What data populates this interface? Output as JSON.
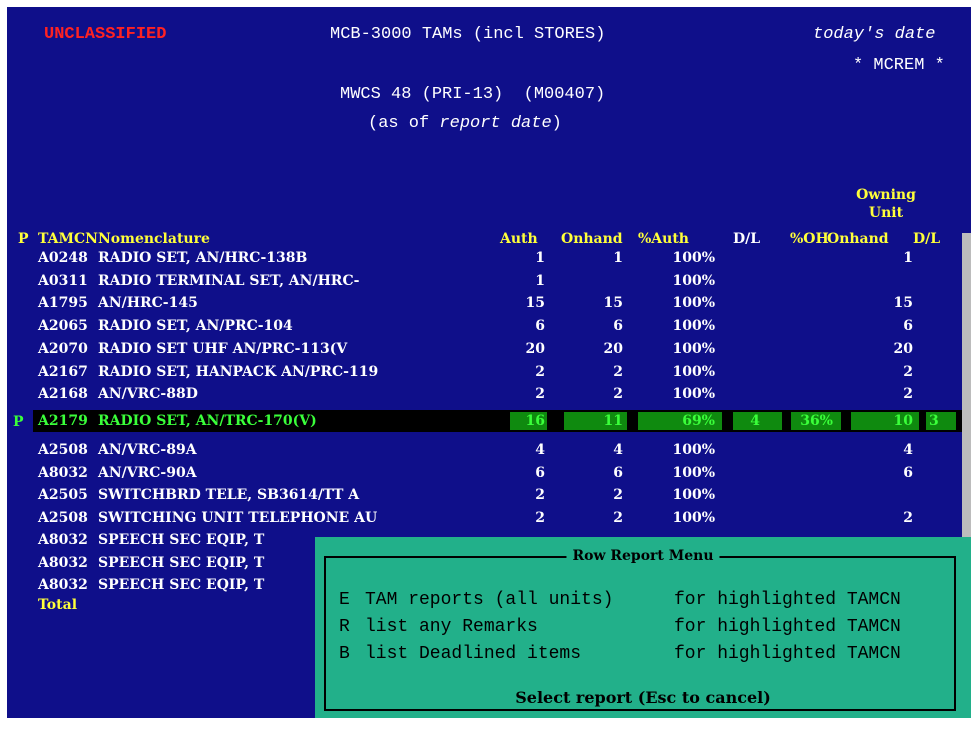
{
  "header": {
    "classification": "UNCLASSIFIED",
    "title": "MCB-3000 TAMs (incl STORES)",
    "date_label": "today's date",
    "command": "* MCREM *",
    "subtitle": "MWCS 48 (PRI-13)  (M00407)",
    "asof_prefix": "(as of ",
    "asof_italic": "report date",
    "asof_suffix": ")"
  },
  "columns": {
    "owning_line1": "Owning",
    "owning_line2": "Unit",
    "p": "P",
    "tamcn": "TAMCN",
    "nomenclature": "Nomenclature",
    "auth": "Auth",
    "onhand": "Onhand",
    "pct_auth": "%Auth",
    "dl": "D/L",
    "pct_oh": "%OH",
    "unit_onhand": "Onhand",
    "unit_dl": "D/L"
  },
  "rows": [
    {
      "tamcn": "A0248",
      "nom": "RADIO SET, AN/HRC-138B",
      "auth": "1",
      "onhand": "1",
      "pct": "100%",
      "dl": "",
      "pctoh": "",
      "uoh": "1",
      "udl": ""
    },
    {
      "tamcn": "A0311",
      "nom": "RADIO TERMINAL SET, AN/HRC-",
      "auth": "1",
      "onhand": "",
      "pct": "100%",
      "dl": "",
      "pctoh": "",
      "uoh": "",
      "udl": ""
    },
    {
      "tamcn": "A1795",
      "nom": "AN/HRC-145",
      "auth": "15",
      "onhand": "15",
      "pct": "100%",
      "dl": "",
      "pctoh": "",
      "uoh": "15",
      "udl": ""
    },
    {
      "tamcn": "A2065",
      "nom": "RADIO SET, AN/PRC-104",
      "auth": "6",
      "onhand": "6",
      "pct": "100%",
      "dl": "",
      "pctoh": "",
      "uoh": "6",
      "udl": ""
    },
    {
      "tamcn": "A2070",
      "nom": "RADIO SET UHF AN/PRC-113(V",
      "auth": "20",
      "onhand": "20",
      "pct": "100%",
      "dl": "",
      "pctoh": "",
      "uoh": "20",
      "udl": ""
    },
    {
      "tamcn": "A2167",
      "nom": "RADIO SET, HANPACK AN/PRC-119",
      "auth": "2",
      "onhand": "2",
      "pct": "100%",
      "dl": "",
      "pctoh": "",
      "uoh": "2",
      "udl": ""
    },
    {
      "tamcn": "A2168",
      "nom": "AN/VRC-88D",
      "auth": "2",
      "onhand": "2",
      "pct": "100%",
      "dl": "",
      "pctoh": "",
      "uoh": "2",
      "udl": ""
    }
  ],
  "highlight_row": {
    "p": "P",
    "tamcn": "A2179",
    "nom": "RADIO SET, AN/TRC-170(V)",
    "auth": "16",
    "onhand": "11",
    "pct": "69%",
    "dl": "4",
    "pctoh": "36%",
    "uoh": "10",
    "udl": "3"
  },
  "rows2": [
    {
      "tamcn": "A2508",
      "nom": "AN/VRC-89A",
      "auth": "4",
      "onhand": "4",
      "pct": "100%",
      "uoh": "4"
    },
    {
      "tamcn": "A8032",
      "nom": "AN/VRC-90A",
      "auth": "6",
      "onhand": "6",
      "pct": "100%",
      "uoh": "6"
    },
    {
      "tamcn": "A2505",
      "nom": "SWITCHBRD TELE, SB3614/TT A",
      "auth": "2",
      "onhand": "2",
      "pct": "100%",
      "uoh": ""
    },
    {
      "tamcn": "A2508",
      "nom": "SWITCHING UNIT TELEPHONE AU",
      "auth": "2",
      "onhand": "2",
      "pct": "100%",
      "uoh": "2"
    }
  ],
  "rows3": [
    {
      "tamcn": "A8032",
      "nom": "SPEECH SEC EQIP, T"
    },
    {
      "tamcn": "A8032",
      "nom": "SPEECH SEC EQIP, T"
    },
    {
      "tamcn": "A8032",
      "nom": "SPEECH SEC EQIP, T"
    }
  ],
  "total_label": "Total",
  "menu": {
    "title": "Row Report Menu",
    "items": [
      {
        "key": "E",
        "text": "TAM reports (all units)",
        "target": "for highlighted TAMCN"
      },
      {
        "key": "R",
        "text": "list any Remarks",
        "target": "for highlighted TAMCN"
      },
      {
        "key": "B",
        "text": "list Deadlined items",
        "target": "for highlighted TAMCN"
      }
    ],
    "prompt": "Select report (Esc to cancel)"
  },
  "colors": {
    "screen_bg": "#0f0f8a",
    "highlight_text": "#3aff3a",
    "menu_bg": "#22b08a",
    "classification": "#ff2222",
    "column_header": "#ffff3a"
  }
}
